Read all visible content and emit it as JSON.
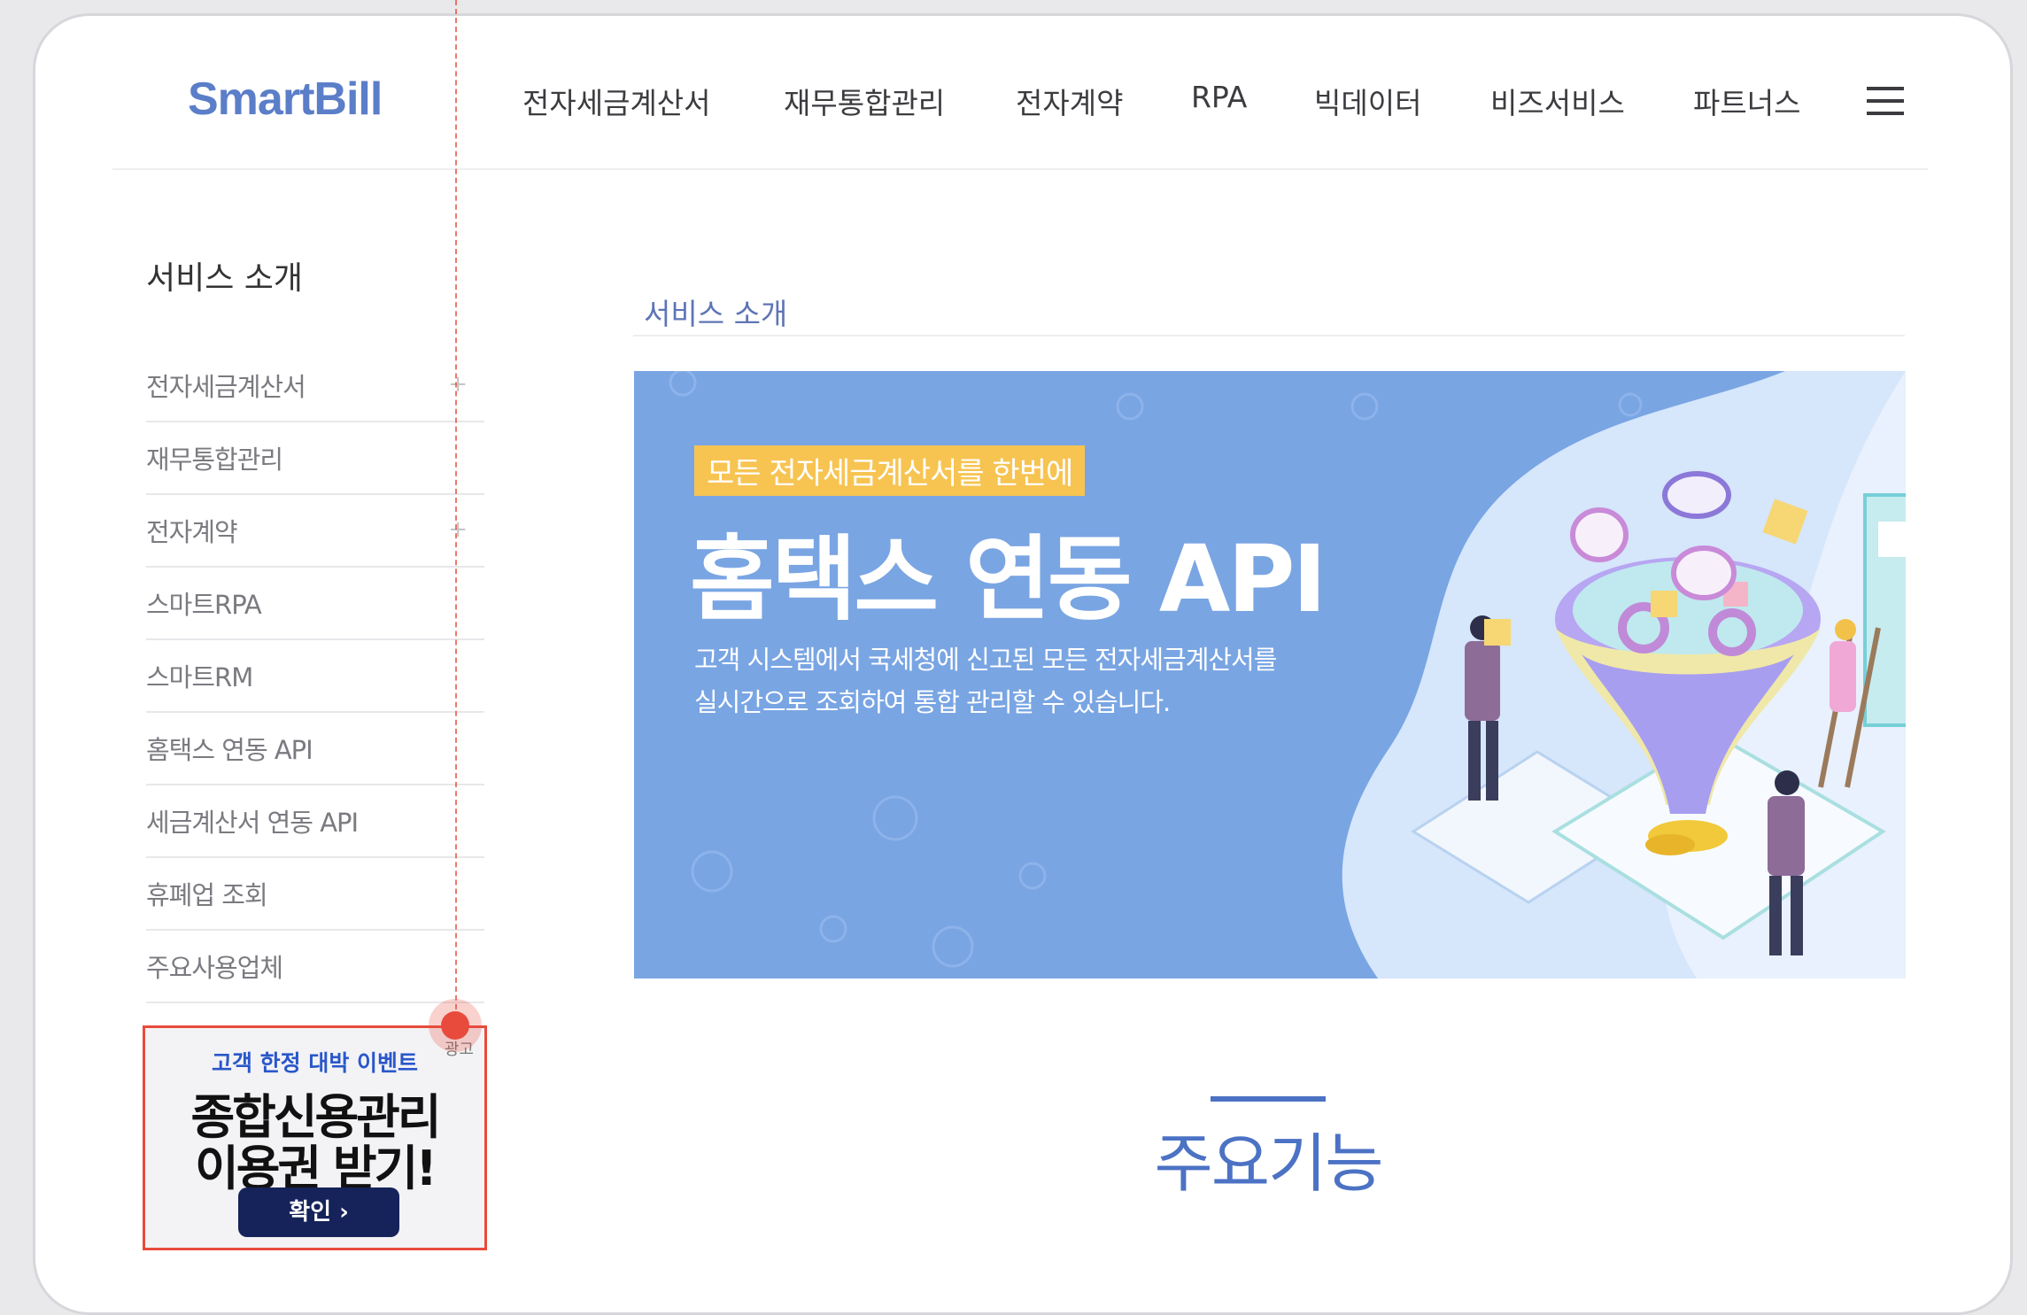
{
  "logo": "SmartBill",
  "nav": {
    "items": [
      "전자세금계산서",
      "재무통합관리",
      "전자계약",
      "RPA",
      "빅데이터",
      "비즈서비스",
      "파트너스"
    ]
  },
  "sidebar": {
    "title": "서비스 소개",
    "items": [
      {
        "label": "전자세금계산서",
        "expandable": true
      },
      {
        "label": "재무통합관리",
        "expandable": false
      },
      {
        "label": "전자계약",
        "expandable": true
      },
      {
        "label": "스마트RPA",
        "expandable": false
      },
      {
        "label": "스마트RM",
        "expandable": false
      },
      {
        "label": "홈택스 연동 API",
        "expandable": false
      },
      {
        "label": "세금계산서 연동 API",
        "expandable": false
      },
      {
        "label": "휴폐업 조회",
        "expandable": false
      },
      {
        "label": "주요사용업체",
        "expandable": false
      }
    ]
  },
  "ad": {
    "tag": "고객 한정 대박 이벤트",
    "badge": "광고",
    "line1": "종합신용관리",
    "line2": "이용권 받기!",
    "button": "확인 ›"
  },
  "main": {
    "breadcrumb": "서비스 소개",
    "hero": {
      "tagline": "모든 전자세금계산서를 한번에",
      "headline": "홈택스 연동 API",
      "desc_line1": "고객 시스템에서 국세청에 신고된 모든 전자세금계산서를",
      "desc_line2": "실시간으로 조회하여 통합 관리할 수 있습니다."
    },
    "features_title": "주요기능"
  },
  "colors": {
    "brand": "#5b7ec8",
    "hero_bg": "#79a5e3",
    "tagline_bg": "#f7c452",
    "ad_border": "#e84b3c",
    "ad_button": "#15235a"
  }
}
